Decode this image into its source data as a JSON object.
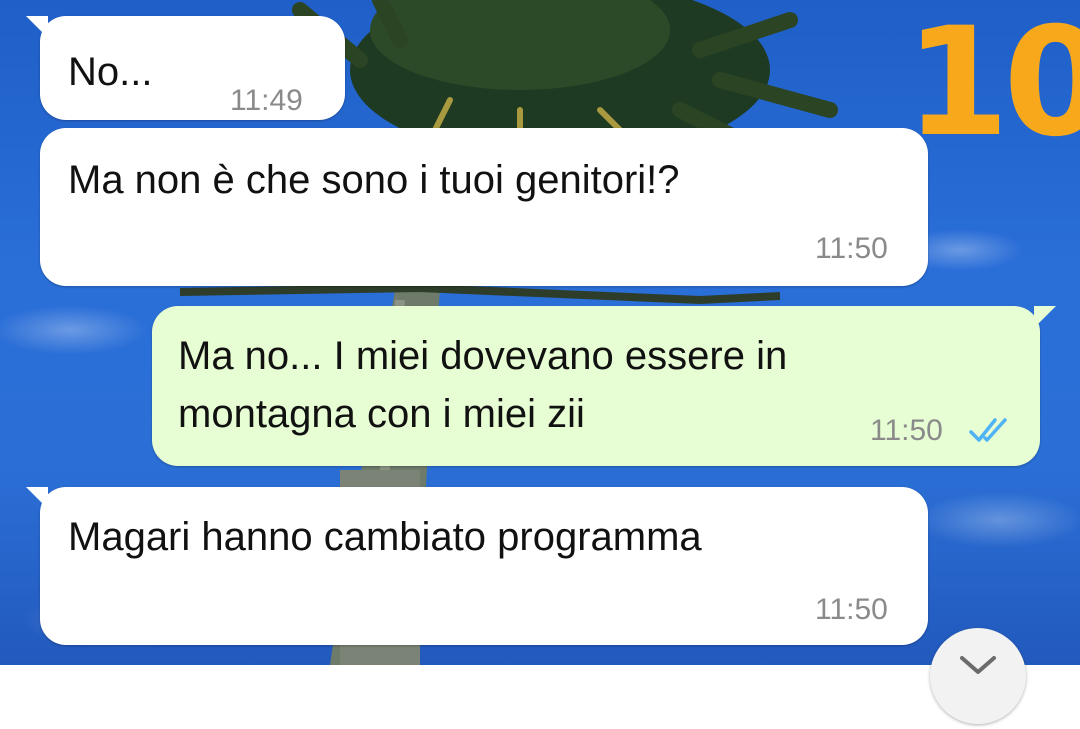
{
  "badge": {
    "number": "10",
    "color": "#f7a81b"
  },
  "messages": [
    {
      "direction": "incoming",
      "text": "No...",
      "time": "11:49"
    },
    {
      "direction": "incoming",
      "text": "Ma non è che sono i tuoi genitori!?",
      "time": "11:50"
    },
    {
      "direction": "outgoing",
      "lines": [
        "Ma no... I miei dovevano essere in",
        "montagna con i miei zii"
      ],
      "time": "11:50",
      "status": "read",
      "status_icon": "double-check-icon"
    },
    {
      "direction": "incoming",
      "text": "Magari hanno cambiato programma",
      "time": "11:50"
    }
  ],
  "scroll_down": {
    "icon": "chevron-down-icon"
  },
  "colors": {
    "incoming_bubble": "#ffffff",
    "outgoing_bubble": "#e7fdd3",
    "read_ticks": "#4fb3f6",
    "wallpaper_sky": "#2a6ed8"
  }
}
